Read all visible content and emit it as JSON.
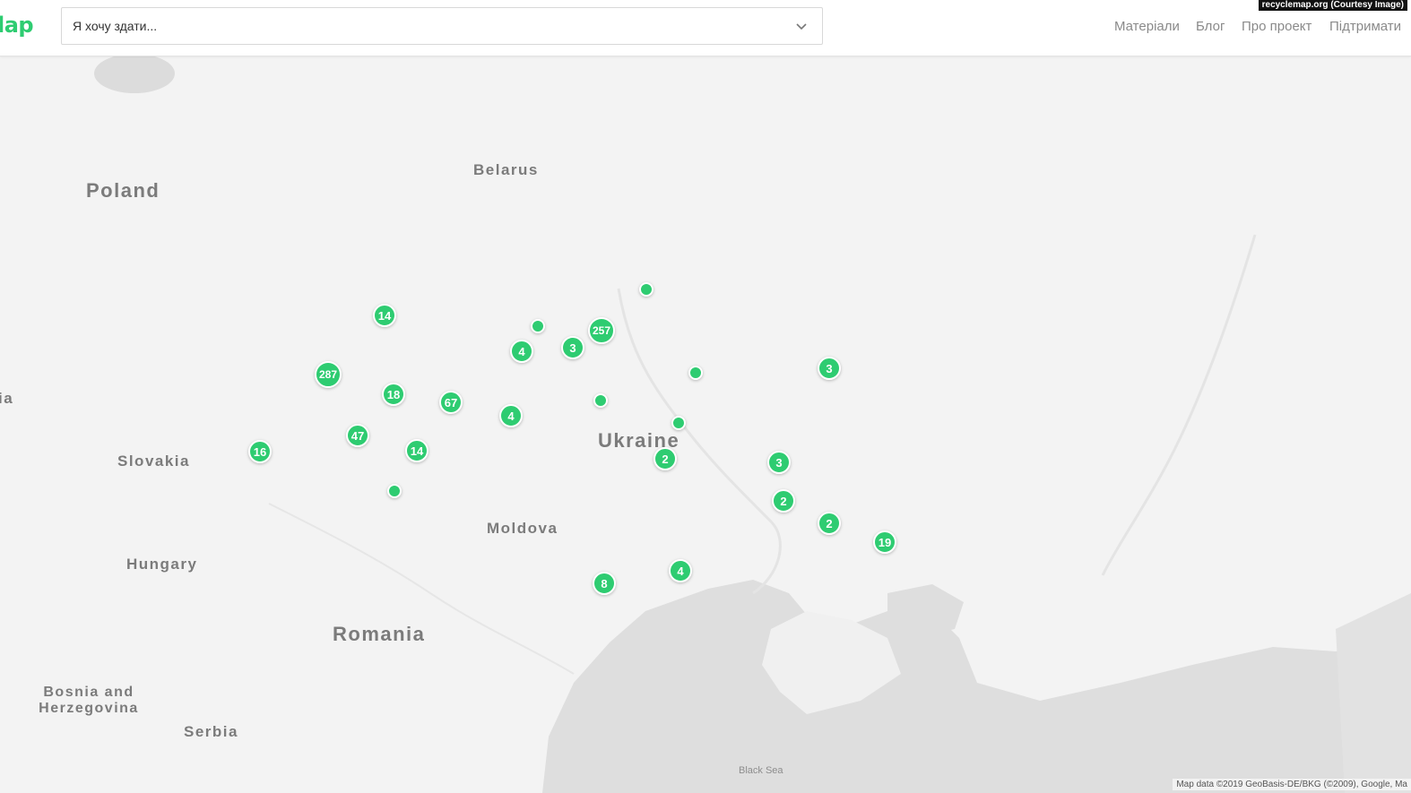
{
  "header": {
    "logo": "lap",
    "search_placeholder": "Я хочу здати...",
    "nav": [
      "Матеріали",
      "Блог",
      "Про проект",
      "Підтримати"
    ],
    "credit": "recyclemap.org (Courtesy Image)"
  },
  "map": {
    "countries": [
      "Poland",
      "Belarus",
      "Ukraine",
      "Slovakia",
      "Moldova",
      "Hungary",
      "Romania",
      "Bosnia and Herzegovina",
      "Serbia"
    ],
    "partial_label": "ia",
    "sea_label": "Black Sea",
    "attribution": "Map data ©2019 GeoBasis-DE/BKG (©2009), Google, Ma",
    "marker_color": "#2ecc71",
    "cluster_counts": [
      "14",
      "257",
      "4",
      "3",
      "287",
      "18",
      "67",
      "4",
      "3",
      "47",
      "14",
      "16",
      "2",
      "3",
      "2",
      "2",
      "19",
      "4",
      "8"
    ]
  }
}
